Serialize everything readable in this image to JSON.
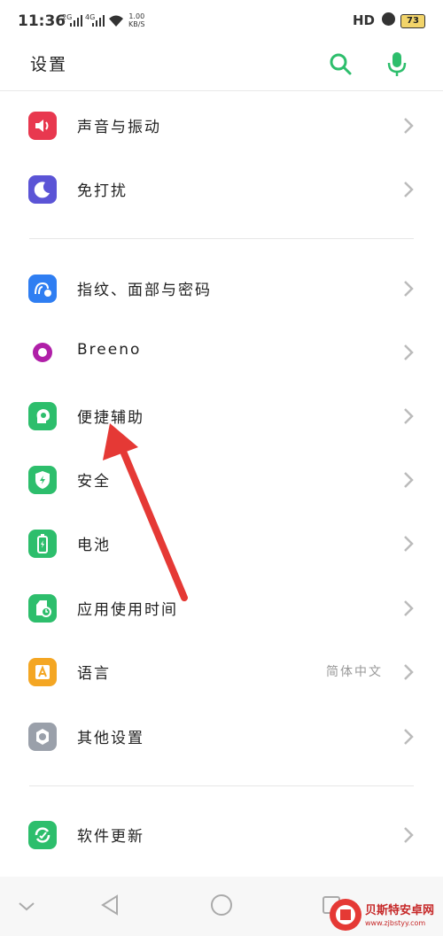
{
  "status_bar": {
    "time": "11:36",
    "signal1_label": "2G",
    "signal2_label": "4G",
    "speed_value": "1.00",
    "speed_unit": "KB/S",
    "hd_label": "HD",
    "battery_level": "73"
  },
  "header": {
    "title": "设置",
    "search_icon": "search-icon",
    "mic_icon": "mic-icon"
  },
  "settings": [
    {
      "label": "声音与振动",
      "icon": "speaker-icon",
      "color": "#e8384f"
    },
    {
      "label": "免打扰",
      "icon": "moon-icon",
      "color": "#5b54d6"
    },
    {
      "label": "指纹、面部与密码",
      "icon": "fingerprint-icon",
      "color": "#2f7ef2"
    },
    {
      "label": "Breeno",
      "icon": "breeno-icon",
      "color": "#b01fa8"
    },
    {
      "label": "便捷辅助",
      "icon": "assist-icon",
      "color": "#2dbe6c"
    },
    {
      "label": "安全",
      "icon": "shield-icon",
      "color": "#2dbe6c"
    },
    {
      "label": "电池",
      "icon": "battery-icon",
      "color": "#2dbe6c"
    },
    {
      "label": "应用使用时间",
      "icon": "app-time-icon",
      "color": "#2dbe6c"
    },
    {
      "label": "语言",
      "value": "简体中文",
      "icon": "language-icon",
      "color": "#f4a623"
    },
    {
      "label": "其他设置",
      "icon": "gear-icon",
      "color": "#9aa0aa"
    },
    {
      "label": "软件更新",
      "icon": "update-icon",
      "color": "#2dbe6c"
    }
  ],
  "annotation": {
    "arrow_color": "#e53935"
  },
  "watermark": {
    "text": "贝斯特安卓网",
    "url": "www.zjbstyy.com"
  }
}
